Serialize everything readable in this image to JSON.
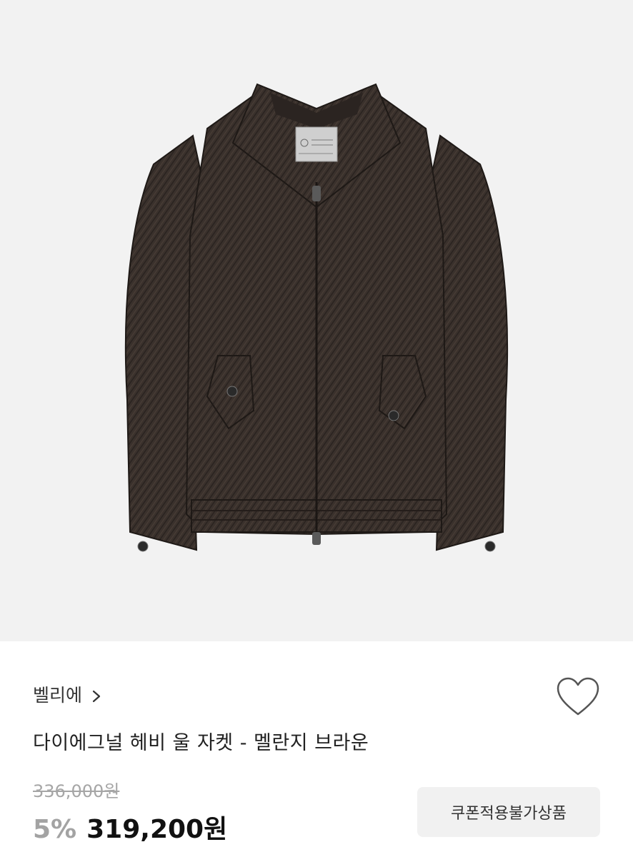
{
  "product": {
    "image_icon": "jacket-product-photo",
    "brand": "벨리에",
    "brand_chevron_icon": "chevron-right-icon",
    "like_icon": "heart-icon",
    "title": "다이에그널 헤비 울 자켓 - 멜란지 브라운",
    "original_price": "336,000원",
    "discount": "5%",
    "sale_price": "319,200원",
    "coupon_notice": "쿠폰적용불가상품"
  },
  "colors": {
    "image_background": "#f2f2f2",
    "jacket": "#3b322d",
    "discount_text": "#a3a3a3",
    "price_text": "#111111",
    "badge_background": "#f1f1f1"
  }
}
